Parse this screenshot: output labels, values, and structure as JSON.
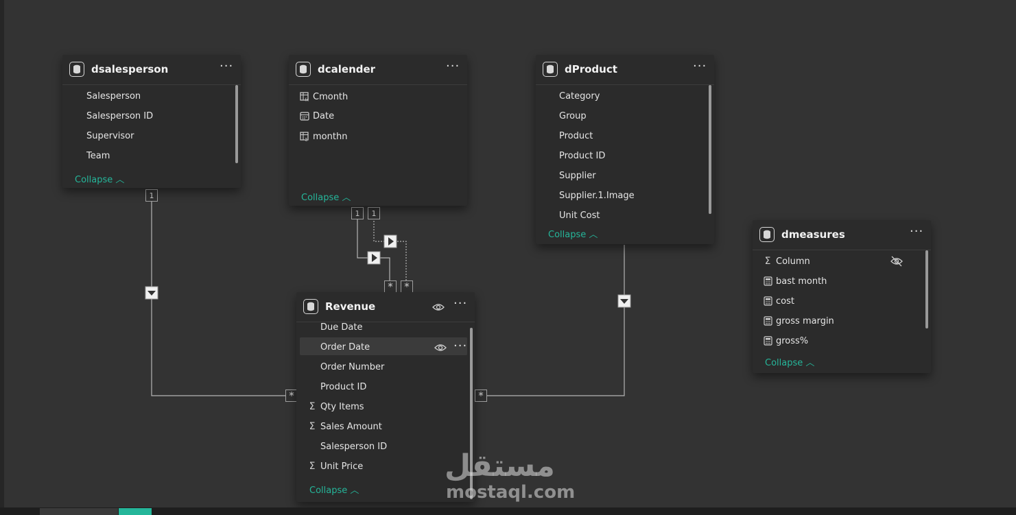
{
  "tables": {
    "dsalesperson": {
      "title": "dsalesperson",
      "fields": [
        "Salesperson",
        "Salesperson ID",
        "Supervisor",
        "Team"
      ],
      "collapse": "Collapse"
    },
    "dcalender": {
      "title": "dcalender",
      "fields": [
        "Cmonth",
        "Date",
        "monthn"
      ],
      "collapse": "Collapse"
    },
    "dproduct": {
      "title": "dProduct",
      "fields": [
        "Category",
        "Group",
        "Product",
        "Product ID",
        "Supplier",
        "Supplier.1.Image",
        "Unit Cost"
      ],
      "collapse": "Collapse"
    },
    "dmeasures": {
      "title": "dmeasures",
      "fields": [
        "Column",
        "bast month",
        "cost",
        "gross margin",
        "gross%"
      ],
      "collapse": "Collapse"
    },
    "revenue": {
      "title": "Revenue",
      "fields": [
        "Due Date",
        "Order Date",
        "Order Number",
        "Product ID",
        "Qty Items",
        "Sales Amount",
        "Salesperson ID",
        "Unit Price"
      ],
      "collapse": "Collapse"
    }
  },
  "relationships": {
    "one": "1",
    "many": "*"
  },
  "watermark": {
    "arabic": "مستقل",
    "latin": "mostaql.com"
  },
  "colors": {
    "canvas": "#333333",
    "card": "#2b2b2b",
    "accent": "#25b69a",
    "line": "#b5b5b5"
  }
}
